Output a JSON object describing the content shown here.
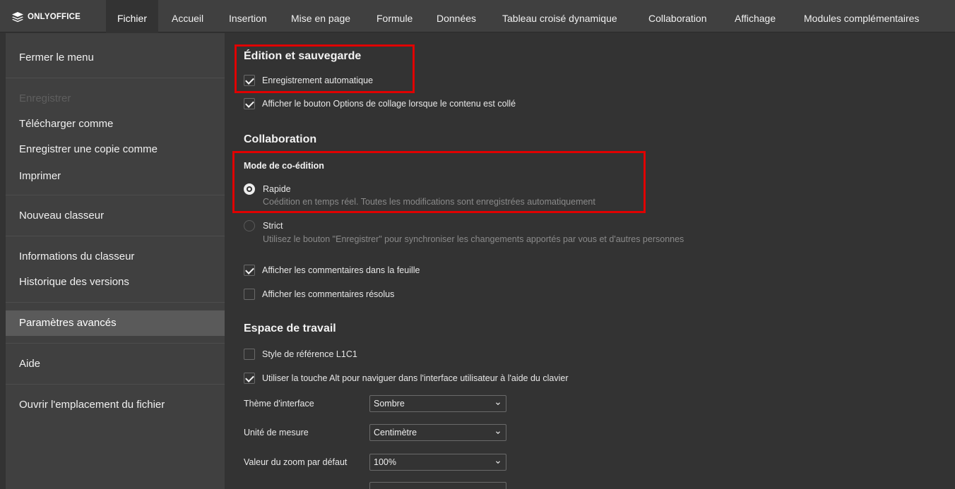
{
  "app": {
    "logo_text": "ONLYOFFICE"
  },
  "menubar": {
    "tabs": [
      {
        "label": "Fichier"
      },
      {
        "label": "Accueil"
      },
      {
        "label": "Insertion"
      },
      {
        "label": "Mise en page"
      },
      {
        "label": "Formule"
      },
      {
        "label": "Données"
      },
      {
        "label": "Tableau croisé dynamique"
      },
      {
        "label": "Collaboration"
      },
      {
        "label": "Affichage"
      },
      {
        "label": "Modules complémentaires"
      }
    ],
    "active_tab": "Fichier"
  },
  "file_menu": {
    "items": [
      {
        "label": "Fermer le menu"
      },
      {
        "label": "Enregistrer",
        "disabled": true
      },
      {
        "label": "Télécharger comme"
      },
      {
        "label": "Enregistrer une copie comme"
      },
      {
        "label": "Imprimer"
      },
      {
        "label": "Nouveau classeur"
      },
      {
        "label": "Informations du classeur"
      },
      {
        "label": "Historique des versions"
      },
      {
        "label": "Paramètres avancés",
        "active": true
      },
      {
        "label": "Aide"
      },
      {
        "label": "Ouvrir l'emplacement du fichier"
      }
    ]
  },
  "settings": {
    "editing": {
      "title": "Édition et sauvegarde",
      "autosave": {
        "label": "Enregistrement automatique",
        "checked": true
      },
      "paste_options": {
        "label": "Afficher le bouton Options de collage lorsque le contenu est collé",
        "checked": true
      }
    },
    "collaboration": {
      "title": "Collaboration",
      "coedit_mode_title": "Mode de co-édition",
      "fast": {
        "label": "Rapide",
        "description": "Coédition en temps réel. Toutes les modifications sont enregistrées automatiquement",
        "selected": true
      },
      "strict": {
        "label": "Strict",
        "description": "Utilisez le bouton \"Enregistrer\" pour synchroniser les changements apportés par vous et d'autres personnes",
        "selected": false
      },
      "show_comments": {
        "label": "Afficher les commentaires dans la feuille",
        "checked": true
      },
      "show_resolved": {
        "label": "Afficher les commentaires résolus",
        "checked": false
      }
    },
    "workspace": {
      "title": "Espace de travail",
      "r1c1": {
        "label": "Style de référence L1C1",
        "checked": false
      },
      "alt_key": {
        "label": "Utiliser la touche Alt pour naviguer dans l'interface utilisateur à l'aide du clavier",
        "checked": true
      },
      "theme": {
        "label": "Thème d'interface",
        "value": "Sombre"
      },
      "unit": {
        "label": "Unité de mesure",
        "value": "Centimètre"
      },
      "zoom": {
        "label": "Valeur du zoom par défaut",
        "value": "100%"
      }
    }
  },
  "colors": {
    "highlight": "#e00000",
    "panel_bg": "#333333",
    "menu_bg": "#404040",
    "active_item_bg": "#5a5a5a"
  }
}
